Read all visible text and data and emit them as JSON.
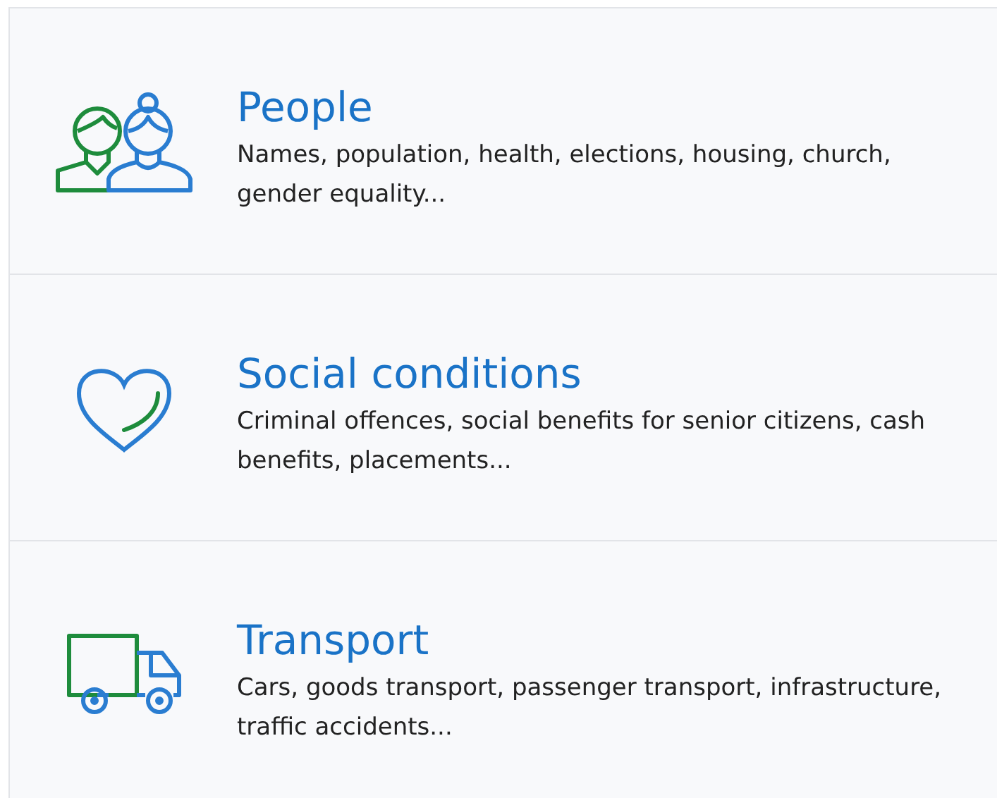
{
  "categories": [
    {
      "kind": "people",
      "title": "People",
      "description": "Names, population, health, elections, housing, church, gender equality..."
    },
    {
      "kind": "heart",
      "title": "Social conditions",
      "description": "Criminal offences, social benefits for senior citizens, cash benefits, placements..."
    },
    {
      "kind": "truck",
      "title": "Transport",
      "description": "Cars, goods transport, passenger transport, infrastructure, traffic accidents..."
    }
  ]
}
